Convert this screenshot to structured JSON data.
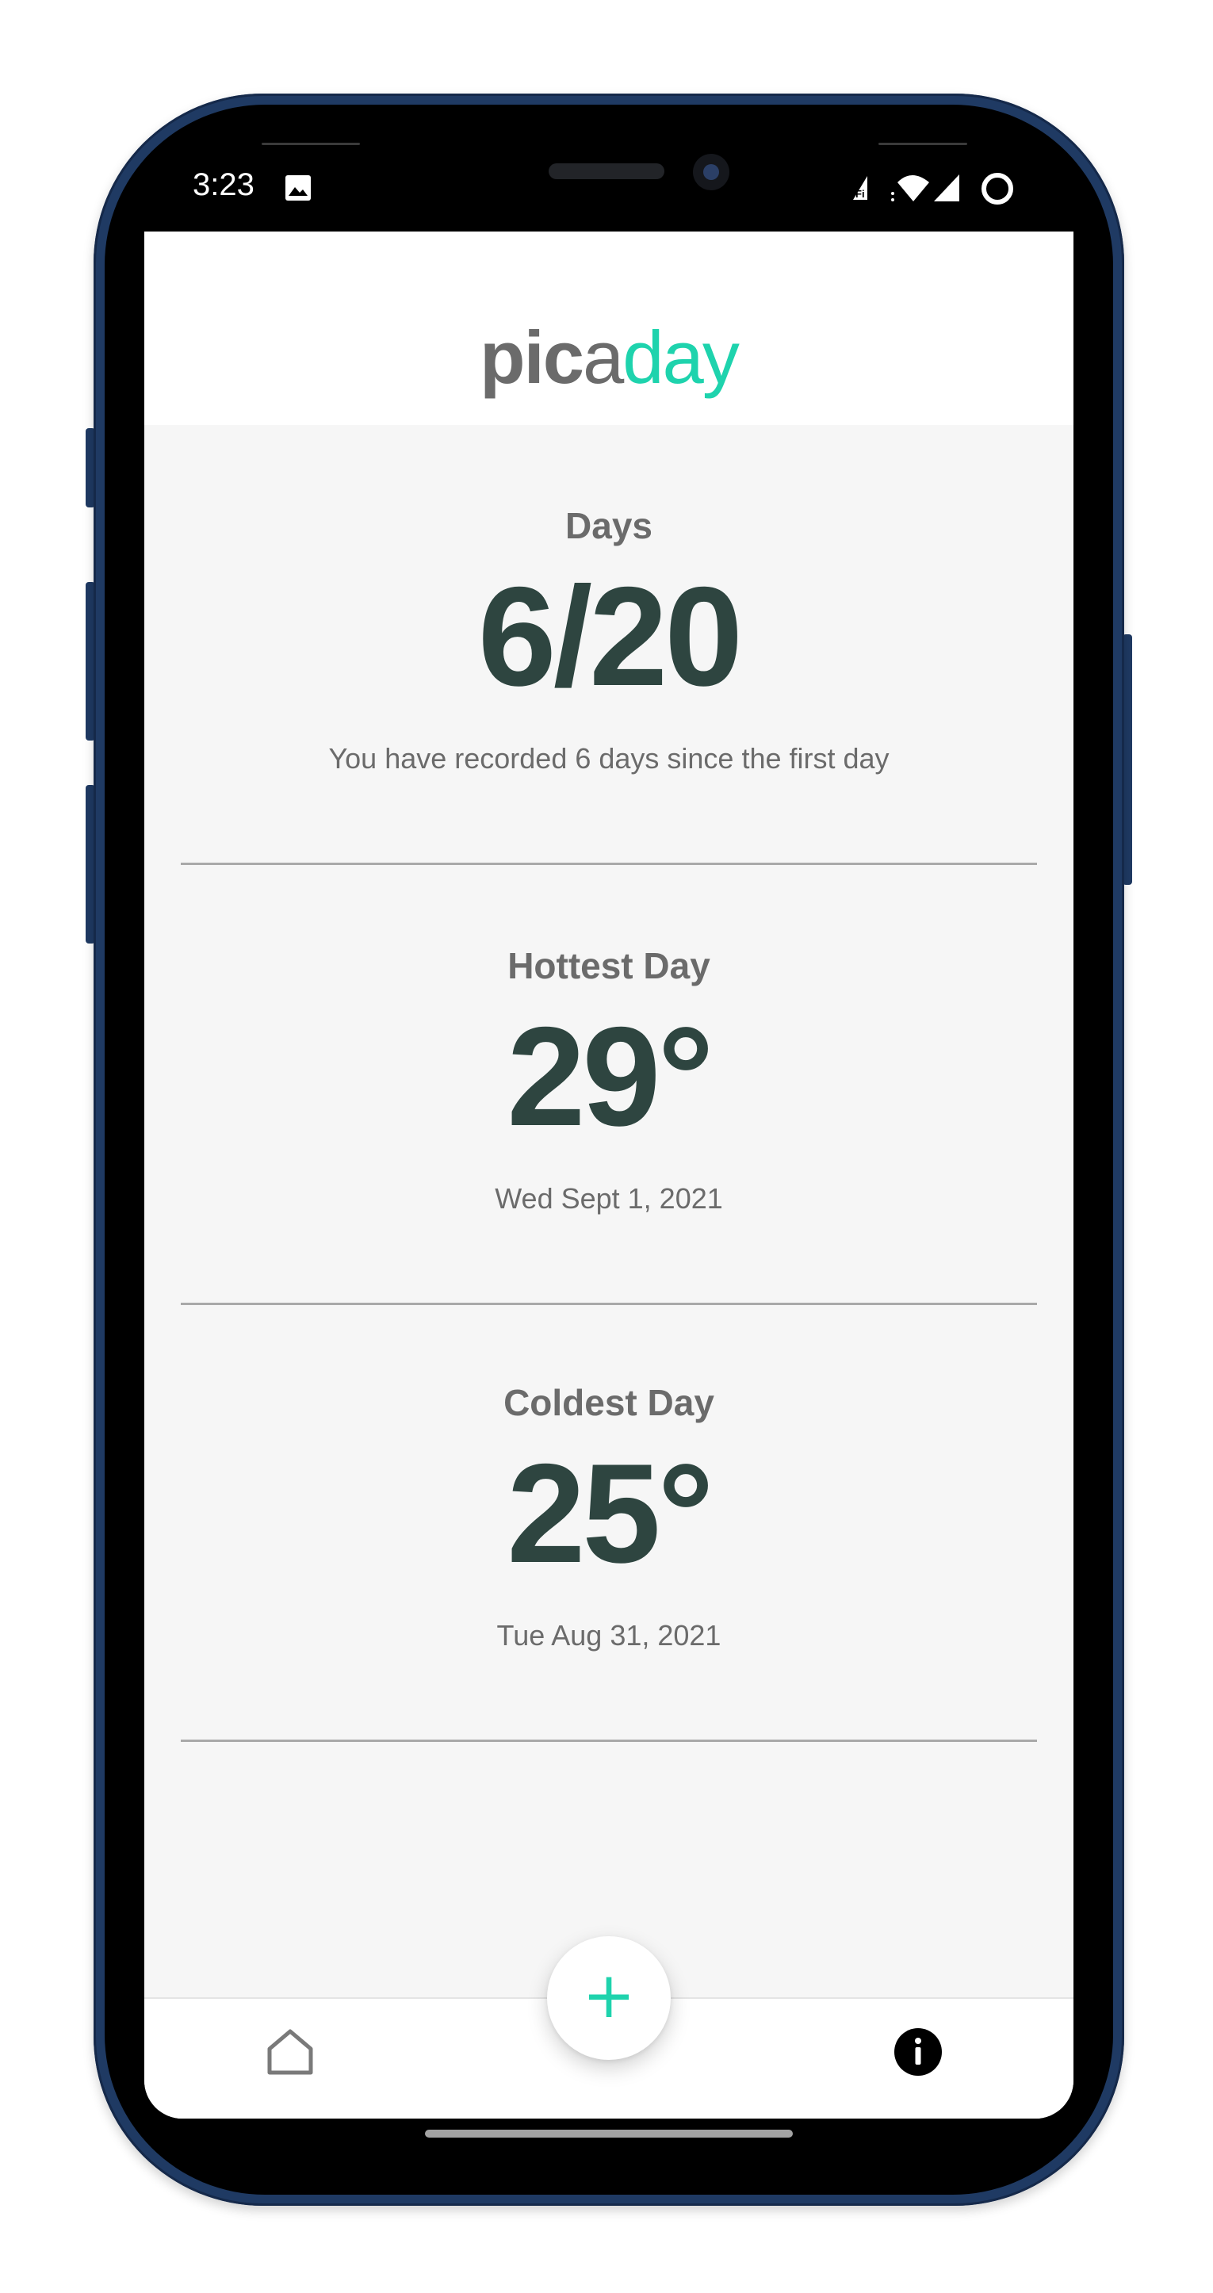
{
  "status_bar": {
    "time": "3:23",
    "icons": [
      "gallery-icon",
      "wifi-calling-icon",
      "wifi-icon",
      "cellular-signal-icon",
      "loading-ring-icon"
    ]
  },
  "app": {
    "logo": {
      "part1": "pic",
      "part2": "a",
      "part3": "day"
    },
    "colors": {
      "accent": "#1ed3ad",
      "heading": "#6b6b6b",
      "value": "#2e4540",
      "background": "#f6f6f6"
    }
  },
  "stats": {
    "days": {
      "label": "Days",
      "value": "6/20",
      "caption": "You have recorded 6 days since the first day"
    },
    "hottest": {
      "label": "Hottest Day",
      "value": "29°",
      "caption": "Wed Sept 1, 2021"
    },
    "coldest": {
      "label": "Coldest Day",
      "value": "25°",
      "caption": "Tue Aug 31, 2021"
    }
  },
  "bottom_nav": {
    "home_icon": "home-icon",
    "add_icon": "plus-icon",
    "add_symbol": "+",
    "info_icon": "info-icon"
  }
}
